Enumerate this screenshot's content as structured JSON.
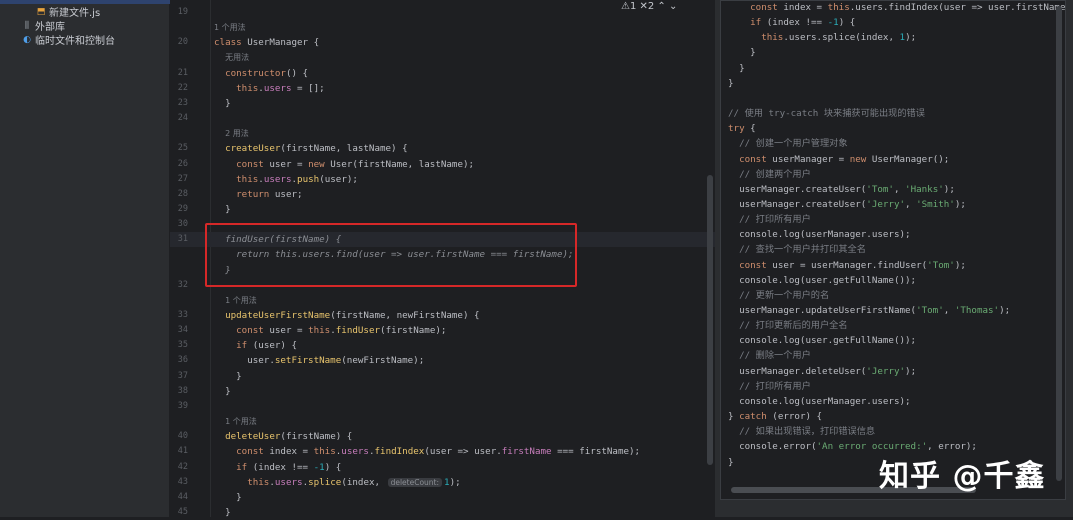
{
  "sidebar": {
    "items": [
      {
        "label": "新建文件.js",
        "icon": "js-file-icon"
      },
      {
        "label": "外部库",
        "icon": "library-icon"
      },
      {
        "label": "临时文件和控制台",
        "icon": "scratch-console-icon"
      }
    ]
  },
  "editor": {
    "status": "⚠1 ✕2 ⌃ ⌄",
    "lines": [
      {
        "num": "19",
        "tokens": []
      },
      {
        "hint": "1 个用法"
      },
      {
        "num": "20",
        "tokens": [
          [
            "class ",
            "k"
          ],
          [
            "UserManager {",
            "t"
          ]
        ]
      },
      {
        "hint": "无用法",
        "indent": "  "
      },
      {
        "num": "21",
        "tokens": [
          [
            "  ",
            "t"
          ],
          [
            "constructor",
            "k"
          ],
          [
            "() {",
            "t"
          ]
        ]
      },
      {
        "num": "22",
        "tokens": [
          [
            "    ",
            "t"
          ],
          [
            "this",
            "k"
          ],
          [
            ".",
            "t"
          ],
          [
            "users",
            "p"
          ],
          [
            " = [];",
            "t"
          ]
        ]
      },
      {
        "num": "23",
        "tokens": [
          [
            "  }",
            "t"
          ]
        ]
      },
      {
        "num": "24",
        "tokens": []
      },
      {
        "hint": "2 用法",
        "indent": "  "
      },
      {
        "num": "25",
        "tokens": [
          [
            "  ",
            "t"
          ],
          [
            "createUser",
            "f"
          ],
          [
            "(firstName, lastName) {",
            "t"
          ]
        ]
      },
      {
        "num": "26",
        "tokens": [
          [
            "    ",
            "t"
          ],
          [
            "const ",
            "k"
          ],
          [
            "user = ",
            "t"
          ],
          [
            "new ",
            "k"
          ],
          [
            "User(firstName, lastName);",
            "t"
          ]
        ]
      },
      {
        "num": "27",
        "tokens": [
          [
            "    ",
            "t"
          ],
          [
            "this",
            "k"
          ],
          [
            ".",
            "t"
          ],
          [
            "users",
            "p"
          ],
          [
            ".",
            "t"
          ],
          [
            "push",
            "f"
          ],
          [
            "(user);",
            "t"
          ]
        ]
      },
      {
        "num": "28",
        "tokens": [
          [
            "    ",
            "t"
          ],
          [
            "return ",
            "k"
          ],
          [
            "user;",
            "t"
          ]
        ]
      },
      {
        "num": "29",
        "tokens": [
          [
            "  }",
            "t"
          ]
        ]
      },
      {
        "num": "30",
        "tokens": []
      },
      {
        "num": "31",
        "current": true,
        "tokens": [
          [
            "  findUser(firstName) {",
            "i"
          ]
        ]
      },
      {
        "tokens": [
          [
            "    return this.users.find(user => user.firstName === firstName);",
            "i"
          ]
        ]
      },
      {
        "tokens": [
          [
            "  }",
            "i"
          ]
        ]
      },
      {
        "num": "32",
        "tokens": []
      },
      {
        "hint": "1 个用法",
        "indent": "  "
      },
      {
        "num": "33",
        "tokens": [
          [
            "  ",
            "t"
          ],
          [
            "updateUserFirstName",
            "f"
          ],
          [
            "(firstName, newFirstName) {",
            "t"
          ]
        ]
      },
      {
        "num": "34",
        "tokens": [
          [
            "    ",
            "t"
          ],
          [
            "const ",
            "k"
          ],
          [
            "user = ",
            "t"
          ],
          [
            "this",
            "k"
          ],
          [
            ".",
            "t"
          ],
          [
            "findUser",
            "f"
          ],
          [
            "(firstName);",
            "t"
          ]
        ]
      },
      {
        "num": "35",
        "tokens": [
          [
            "    ",
            "t"
          ],
          [
            "if ",
            "k"
          ],
          [
            "(user) {",
            "t"
          ]
        ]
      },
      {
        "num": "36",
        "tokens": [
          [
            "      user.",
            "t"
          ],
          [
            "setFirstName",
            "f"
          ],
          [
            "(newFirstName);",
            "t"
          ]
        ]
      },
      {
        "num": "37",
        "tokens": [
          [
            "    }",
            "t"
          ]
        ]
      },
      {
        "num": "38",
        "tokens": [
          [
            "  }",
            "t"
          ]
        ]
      },
      {
        "num": "39",
        "tokens": []
      },
      {
        "hint": "1 个用法",
        "indent": "  "
      },
      {
        "num": "40",
        "tokens": [
          [
            "  ",
            "t"
          ],
          [
            "deleteUser",
            "f"
          ],
          [
            "(firstName) {",
            "t"
          ]
        ]
      },
      {
        "num": "41",
        "tokens": [
          [
            "    ",
            "t"
          ],
          [
            "const ",
            "k"
          ],
          [
            "index = ",
            "t"
          ],
          [
            "this",
            "k"
          ],
          [
            ".",
            "t"
          ],
          [
            "users",
            "p"
          ],
          [
            ".",
            "t"
          ],
          [
            "findIndex",
            "f"
          ],
          [
            "(user => user.",
            "t"
          ],
          [
            "firstName",
            "p"
          ],
          [
            " === firstName);",
            "t"
          ]
        ]
      },
      {
        "num": "42",
        "tokens": [
          [
            "    ",
            "t"
          ],
          [
            "if ",
            "k"
          ],
          [
            "(index !== ",
            "t"
          ],
          [
            "-1",
            "n"
          ],
          [
            ") {",
            "t"
          ]
        ]
      },
      {
        "num": "43",
        "tokens": [
          [
            "      ",
            "t"
          ],
          [
            "this",
            "k"
          ],
          [
            ".",
            "t"
          ],
          [
            "users",
            "p"
          ],
          [
            ".",
            "t"
          ],
          [
            "splice",
            "f"
          ],
          [
            "(index, ",
            "t"
          ],
          [
            "deleteCount:",
            "badge"
          ],
          [
            "1",
            "n"
          ],
          [
            ");",
            "t"
          ]
        ]
      },
      {
        "num": "44",
        "tokens": [
          [
            "    }",
            "t"
          ]
        ]
      },
      {
        "num": "45",
        "tokens": [
          [
            "  }",
            "t"
          ]
        ]
      }
    ]
  },
  "preview": {
    "watermark": "知乎 @千鑫",
    "lines": [
      {
        "tokens": [
          [
            "    ",
            "t"
          ],
          [
            "const ",
            "k"
          ],
          [
            "index = ",
            "t"
          ],
          [
            "this",
            "k"
          ],
          [
            ".users.findIndex(user => user.firstName",
            "t"
          ]
        ]
      },
      {
        "tokens": [
          [
            "    ",
            "t"
          ],
          [
            "if ",
            "k"
          ],
          [
            "(index !== ",
            "t"
          ],
          [
            "-1",
            "n"
          ],
          [
            ") {",
            "t"
          ]
        ]
      },
      {
        "tokens": [
          [
            "      ",
            "t"
          ],
          [
            "this",
            "k"
          ],
          [
            ".users.splice(index, ",
            "t"
          ],
          [
            "1",
            "n"
          ],
          [
            ");",
            "t"
          ]
        ]
      },
      {
        "tokens": [
          [
            "    }",
            "t"
          ]
        ]
      },
      {
        "tokens": [
          [
            "  }",
            "t"
          ]
        ]
      },
      {
        "tokens": [
          [
            "}",
            "t"
          ]
        ]
      },
      {
        "tokens": []
      },
      {
        "tokens": [
          [
            "// 使用 try-catch 块来捕获可能出现的错误",
            "c"
          ]
        ]
      },
      {
        "tokens": [
          [
            "try ",
            "k"
          ],
          [
            "{",
            "t"
          ]
        ]
      },
      {
        "tokens": [
          [
            "  // 创建一个用户管理对象",
            "c"
          ]
        ]
      },
      {
        "tokens": [
          [
            "  ",
            "t"
          ],
          [
            "const ",
            "k"
          ],
          [
            "userManager = ",
            "t"
          ],
          [
            "new ",
            "k"
          ],
          [
            "UserManager();",
            "t"
          ]
        ]
      },
      {
        "tokens": [
          [
            "  // 创建两个用户",
            "c"
          ]
        ]
      },
      {
        "tokens": [
          [
            "  userManager.createUser(",
            "t"
          ],
          [
            "'Tom'",
            "s"
          ],
          [
            ", ",
            "t"
          ],
          [
            "'Hanks'",
            "s"
          ],
          [
            ");",
            "t"
          ]
        ]
      },
      {
        "tokens": [
          [
            "  userManager.createUser(",
            "t"
          ],
          [
            "'Jerry'",
            "s"
          ],
          [
            ", ",
            "t"
          ],
          [
            "'Smith'",
            "s"
          ],
          [
            ");",
            "t"
          ]
        ]
      },
      {
        "tokens": [
          [
            "  // 打印所有用户",
            "c"
          ]
        ]
      },
      {
        "tokens": [
          [
            "  console.log(userManager.users);",
            "t"
          ]
        ]
      },
      {
        "tokens": [
          [
            "  // 查找一个用户并打印其全名",
            "c"
          ]
        ]
      },
      {
        "tokens": [
          [
            "  ",
            "t"
          ],
          [
            "const ",
            "k"
          ],
          [
            "user = userManager.findUser(",
            "t"
          ],
          [
            "'Tom'",
            "s"
          ],
          [
            ");",
            "t"
          ]
        ]
      },
      {
        "tokens": [
          [
            "  console.log(user.getFullName());",
            "t"
          ]
        ]
      },
      {
        "tokens": [
          [
            "  // 更新一个用户的名",
            "c"
          ]
        ]
      },
      {
        "tokens": [
          [
            "  userManager.updateUserFirstName(",
            "t"
          ],
          [
            "'Tom'",
            "s"
          ],
          [
            ", ",
            "t"
          ],
          [
            "'Thomas'",
            "s"
          ],
          [
            ");",
            "t"
          ]
        ]
      },
      {
        "tokens": [
          [
            "  // 打印更新后的用户全名",
            "c"
          ]
        ]
      },
      {
        "tokens": [
          [
            "  console.log(user.getFullName());",
            "t"
          ]
        ]
      },
      {
        "tokens": [
          [
            "  // 删除一个用户",
            "c"
          ]
        ]
      },
      {
        "tokens": [
          [
            "  userManager.deleteUser(",
            "t"
          ],
          [
            "'Jerry'",
            "s"
          ],
          [
            ");",
            "t"
          ]
        ]
      },
      {
        "tokens": [
          [
            "  // 打印所有用户",
            "c"
          ]
        ]
      },
      {
        "tokens": [
          [
            "  console.log(userManager.users);",
            "t"
          ]
        ]
      },
      {
        "tokens": [
          [
            "} ",
            "t"
          ],
          [
            "catch ",
            "k"
          ],
          [
            "(error) {",
            "t"
          ]
        ]
      },
      {
        "tokens": [
          [
            "  // 如果出现错误，打印错误信息",
            "c"
          ]
        ]
      },
      {
        "tokens": [
          [
            "  console.error(",
            "t"
          ],
          [
            "'An error occurred:'",
            "s"
          ],
          [
            ", error);",
            "t"
          ]
        ]
      },
      {
        "tokens": [
          [
            "}",
            "t"
          ]
        ]
      }
    ]
  }
}
